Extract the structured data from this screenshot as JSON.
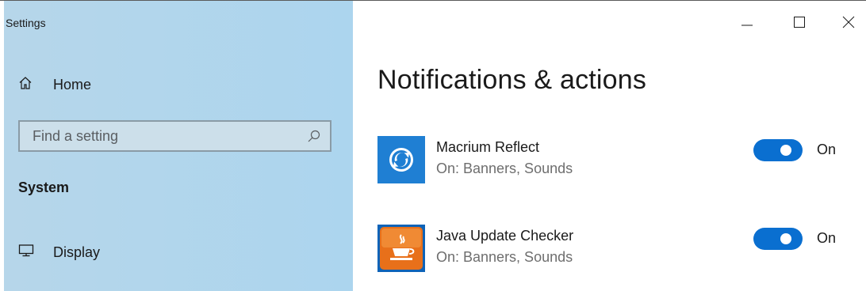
{
  "window": {
    "title": "Settings",
    "controls": {
      "minimize_icon": "minimize-icon",
      "maximize_icon": "maximize-icon",
      "close_icon": "close-icon"
    }
  },
  "sidebar": {
    "home_label": "Home",
    "search": {
      "placeholder": "Find a setting",
      "value": ""
    },
    "section_heading": "System",
    "items": [
      {
        "label": "Display",
        "icon": "display-icon"
      }
    ]
  },
  "main": {
    "title": "Notifications & actions",
    "apps": [
      {
        "name": "Macrium Reflect",
        "status": "On: Banners, Sounds",
        "toggle_on": true,
        "toggle_label": "On",
        "icon": "macrium-reflect-icon",
        "icon_color": "#1f7fd3"
      },
      {
        "name": "Java Update Checker",
        "status": "On: Banners, Sounds",
        "toggle_on": true,
        "toggle_label": "On",
        "icon": "java-update-checker-icon",
        "icon_color": "#e8701a"
      }
    ]
  },
  "colors": {
    "accent": "#0a6fd0",
    "sidebar_bg": "#acd5ee"
  }
}
